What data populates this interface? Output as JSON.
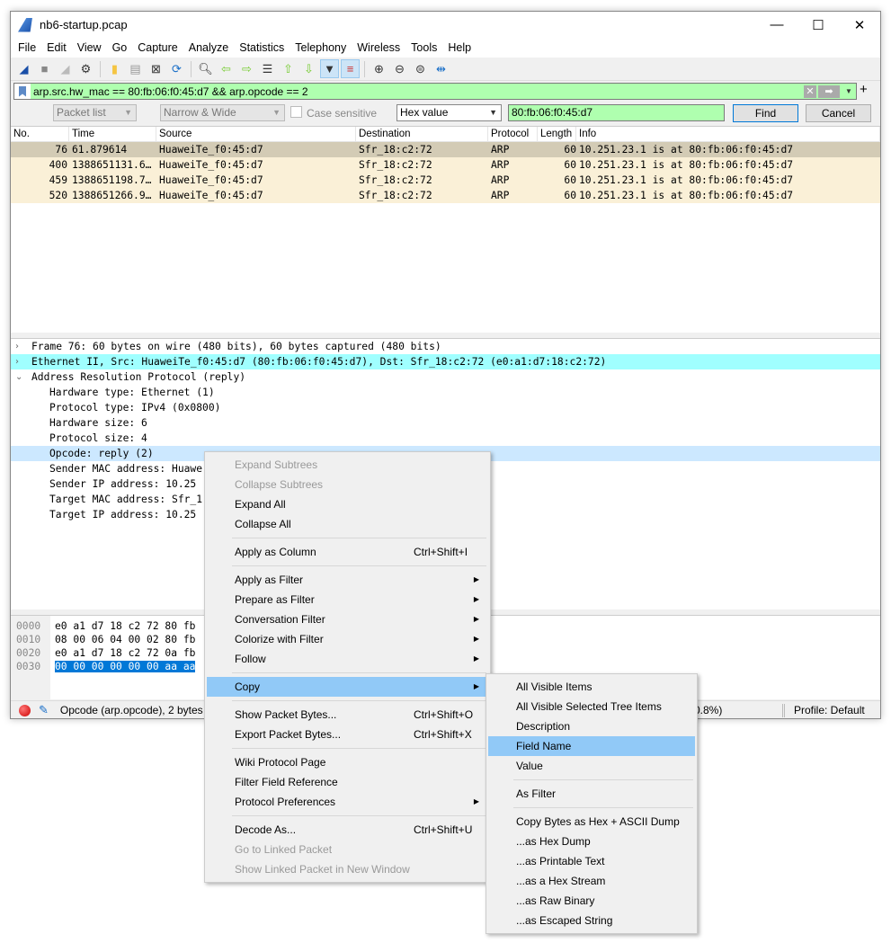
{
  "window": {
    "title": "nb6-startup.pcap",
    "minimize": "—",
    "maximize": "☐",
    "close": "✕"
  },
  "menubar": [
    "File",
    "Edit",
    "View",
    "Go",
    "Capture",
    "Analyze",
    "Statistics",
    "Telephony",
    "Wireless",
    "Tools",
    "Help"
  ],
  "toolbar_icons": [
    "start-capture-icon",
    "stop-capture-icon",
    "restart-capture-icon",
    "capture-options-icon",
    "open-file-icon",
    "save-file-icon",
    "close-file-icon",
    "reload-file-icon",
    "find-packet-icon",
    "go-back-icon",
    "go-forward-icon",
    "go-to-packet-icon",
    "first-packet-icon",
    "last-packet-icon",
    "autoscroll-icon",
    "colorize-icon",
    "zoom-in-icon",
    "zoom-out-icon",
    "normal-size-icon",
    "resize-columns-icon"
  ],
  "filter": {
    "value": "arp.src.hw_mac == 80:fb:06:f0:45:d7 && arp.opcode == 2",
    "color": "#afffaf"
  },
  "findbar": {
    "search_in": "Packet list",
    "char_width": "Narrow & Wide",
    "case_sensitive_label": "Case sensitive",
    "case_sensitive": false,
    "search_type": "Hex value",
    "search_value": "80:fb:06:f0:45:d7",
    "find_label": "Find",
    "cancel_label": "Cancel"
  },
  "packet_list": {
    "columns": [
      "No.",
      "Time",
      "Source",
      "Destination",
      "Protocol",
      "Length",
      "Info"
    ],
    "rows": [
      [
        "76",
        "61.879614",
        "HuaweiTe_f0:45:d7",
        "Sfr_18:c2:72",
        "ARP",
        "60",
        "10.251.23.1 is at 80:fb:06:f0:45:d7"
      ],
      [
        "400",
        "1388651131.6…",
        "HuaweiTe_f0:45:d7",
        "Sfr_18:c2:72",
        "ARP",
        "60",
        "10.251.23.1 is at 80:fb:06:f0:45:d7"
      ],
      [
        "459",
        "1388651198.7…",
        "HuaweiTe_f0:45:d7",
        "Sfr_18:c2:72",
        "ARP",
        "60",
        "10.251.23.1 is at 80:fb:06:f0:45:d7"
      ],
      [
        "520",
        "1388651266.9…",
        "HuaweiTe_f0:45:d7",
        "Sfr_18:c2:72",
        "ARP",
        "60",
        "10.251.23.1 is at 80:fb:06:f0:45:d7"
      ]
    ],
    "selected_row": 0
  },
  "details": {
    "top": [
      "Frame 76: 60 bytes on wire (480 bits), 60 bytes captured (480 bits)",
      "Ethernet II, Src: HuaweiTe_f0:45:d7 (80:fb:06:f0:45:d7), Dst: Sfr_18:c2:72 (e0:a1:d7:18:c2:72)",
      "Address Resolution Protocol (reply)"
    ],
    "arp": [
      "Hardware type: Ethernet (1)",
      "Protocol type: IPv4 (0x0800)",
      "Hardware size: 6",
      "Protocol size: 4",
      "Opcode: reply (2)",
      "Sender MAC address: Huawe",
      "Sender IP address: 10.25",
      "Target MAC address: Sfr_1",
      "Target IP address: 10.25"
    ]
  },
  "hex": {
    "rows": [
      [
        "0000",
        "e0 a1 d7 18 c2 72 80 fb"
      ],
      [
        "0010",
        "08 00 06 04 00 02 80 fb"
      ],
      [
        "0020",
        "e0 a1 d7 18 c2 72 0a fb"
      ],
      [
        "0030",
        "00 00 00 00 00 00 aa aa"
      ]
    ]
  },
  "status": {
    "field": "Opcode (arp.opcode), 2 bytes",
    "packets": "0.8%)",
    "profile": "Profile: Default"
  },
  "context_menu": {
    "items": [
      {
        "label": "Expand Subtrees",
        "disabled": true
      },
      {
        "label": "Collapse Subtrees",
        "disabled": true
      },
      {
        "label": "Expand All"
      },
      {
        "label": "Collapse All"
      },
      {
        "sep": true
      },
      {
        "label": "Apply as Column",
        "shortcut": "Ctrl+Shift+I"
      },
      {
        "sep": true
      },
      {
        "label": "Apply as Filter",
        "submenu": true
      },
      {
        "label": "Prepare as Filter",
        "submenu": true
      },
      {
        "label": "Conversation Filter",
        "submenu": true
      },
      {
        "label": "Colorize with Filter",
        "submenu": true
      },
      {
        "label": "Follow",
        "submenu": true
      },
      {
        "sep": true
      },
      {
        "label": "Copy",
        "submenu": true,
        "highlighted": true
      },
      {
        "sep": true
      },
      {
        "label": "Show Packet Bytes...",
        "shortcut": "Ctrl+Shift+O"
      },
      {
        "label": "Export Packet Bytes...",
        "shortcut": "Ctrl+Shift+X"
      },
      {
        "sep": true
      },
      {
        "label": "Wiki Protocol Page"
      },
      {
        "label": "Filter Field Reference"
      },
      {
        "label": "Protocol Preferences",
        "submenu": true
      },
      {
        "sep": true
      },
      {
        "label": "Decode As...",
        "shortcut": "Ctrl+Shift+U"
      },
      {
        "label": "Go to Linked Packet",
        "disabled": true
      },
      {
        "label": "Show Linked Packet in New Window",
        "disabled": true
      }
    ]
  },
  "copy_submenu": {
    "items": [
      {
        "label": "All Visible Items"
      },
      {
        "label": "All Visible Selected Tree Items"
      },
      {
        "label": "Description"
      },
      {
        "label": "Field Name",
        "highlighted": true
      },
      {
        "label": "Value"
      },
      {
        "sep": true
      },
      {
        "label": "As Filter"
      },
      {
        "sep": true
      },
      {
        "label": "Copy Bytes as Hex + ASCII Dump"
      },
      {
        "label": "...as Hex Dump"
      },
      {
        "label": "...as Printable Text"
      },
      {
        "label": "...as a Hex Stream"
      },
      {
        "label": "...as Raw Binary"
      },
      {
        "label": "...as Escaped String"
      }
    ]
  }
}
